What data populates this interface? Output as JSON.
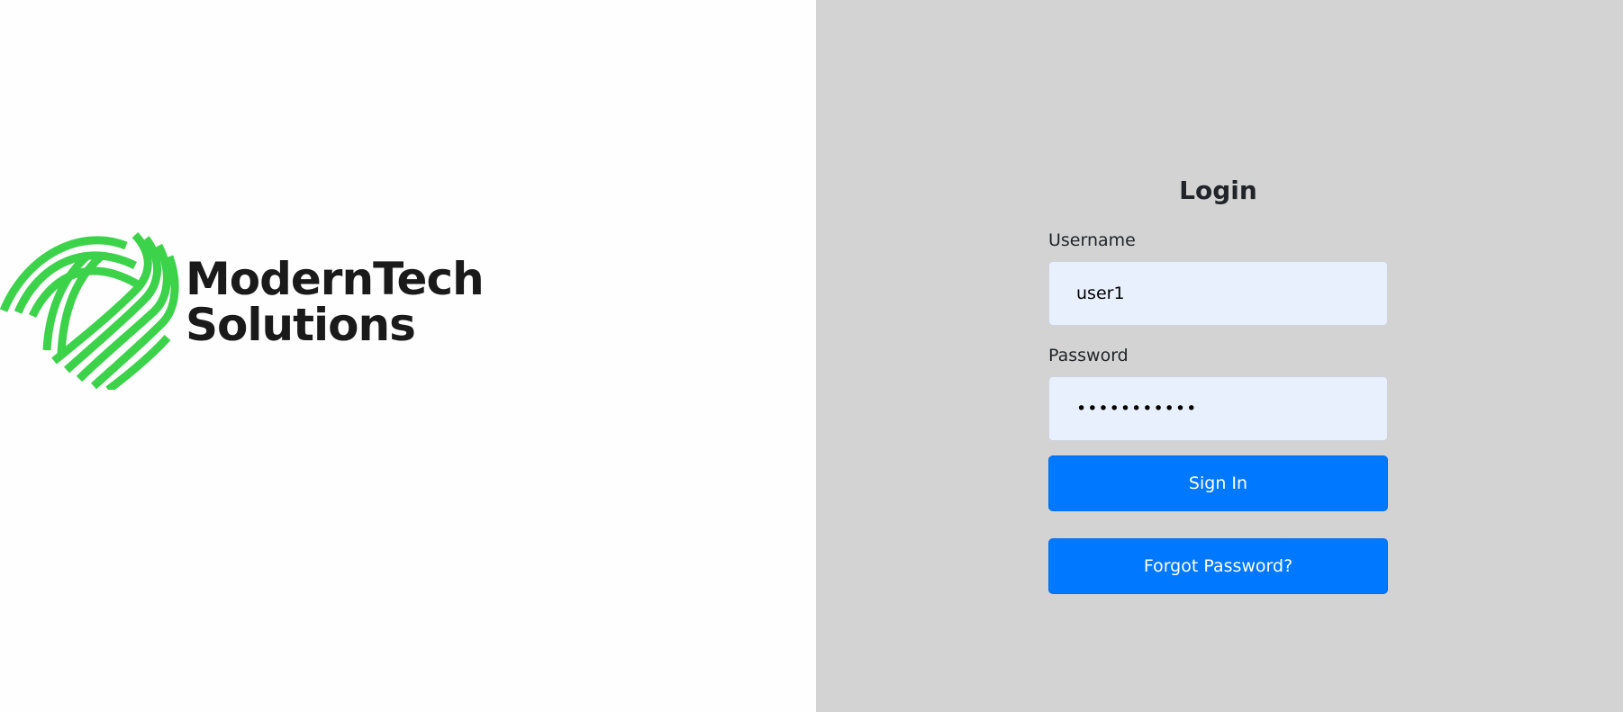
{
  "brand": {
    "line1": "ModernTech",
    "line2": "Solutions",
    "accent_color": "#3cd24a",
    "text_color": "#1a1a1a"
  },
  "login": {
    "title": "Login",
    "username_label": "Username",
    "username_value": "user1",
    "password_label": "Password",
    "password_value": "user1234567",
    "sign_in_label": "Sign In",
    "forgot_label": "Forgot Password?"
  },
  "colors": {
    "left_bg": "#fefefe",
    "right_bg": "#d3d3d3",
    "button": "#0078ff",
    "input_bg": "#e8f0fe"
  }
}
